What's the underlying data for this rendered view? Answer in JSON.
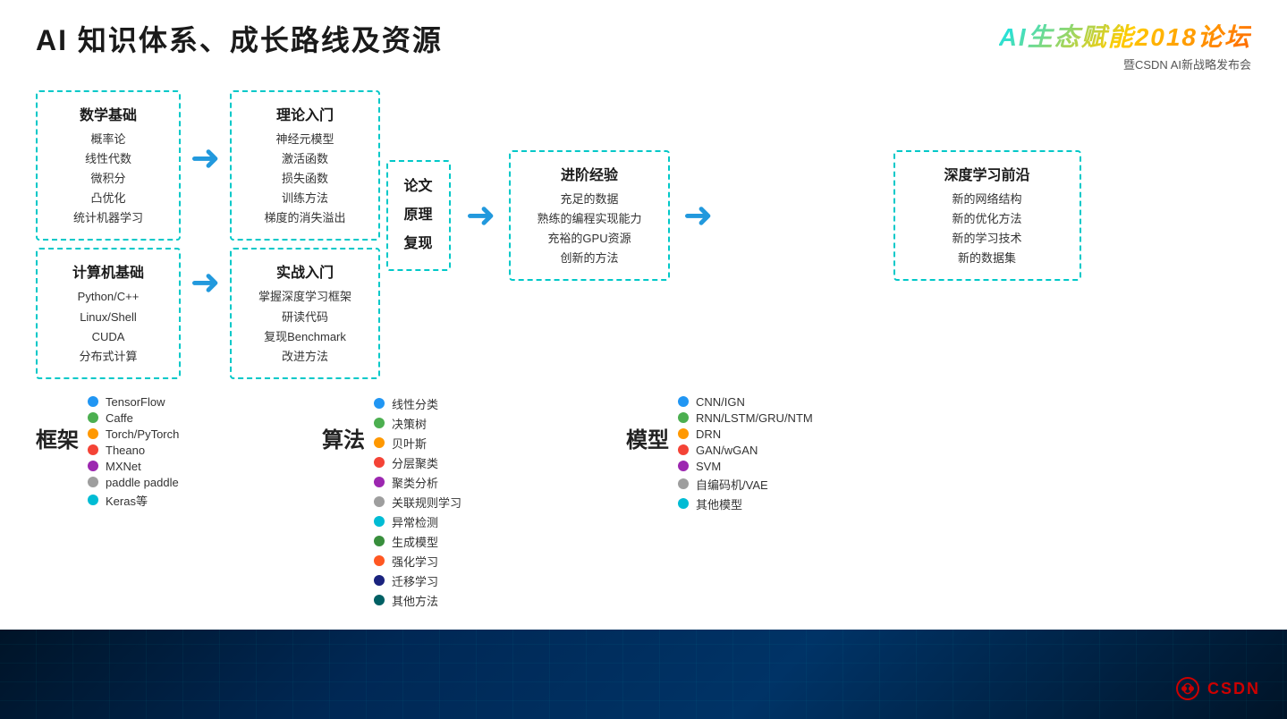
{
  "header": {
    "main_title": "AI 知识体系、成长路线及资源",
    "logo_title": "AI生态赋能2018论坛",
    "logo_subtitle": "暨CSDN AI新战略发布会"
  },
  "boxes": {
    "shuxue": {
      "title": "数学基础",
      "items": [
        "概率论",
        "线性代数",
        "微积分",
        "凸优化",
        "统计机器学习"
      ]
    },
    "jisuanji": {
      "title": "计算机基础",
      "items": [
        "Python/C++",
        "Linux/Shell",
        "CUDA",
        "分布式计算"
      ]
    },
    "lilun": {
      "title": "理论入门",
      "items": [
        "神经元模型",
        "激活函数",
        "损失函数",
        "训练方法",
        "梯度的消失溢出"
      ]
    },
    "shizhan": {
      "title": "实战入门",
      "items": [
        "掌握深度学习框架",
        "研读代码",
        "复现Benchmark",
        "改进方法"
      ]
    },
    "lunwen": {
      "lines": [
        "论文",
        "原理",
        "复现"
      ]
    },
    "jinjie": {
      "title": "进阶经验",
      "items": [
        "充足的数据",
        "熟练的编程实现能力",
        "充裕的GPU资源",
        "创新的方法"
      ]
    },
    "shendu": {
      "title": "深度学习前沿",
      "items": [
        "新的网络结构",
        "新的优化方法",
        "新的学习技术",
        "新的数据集"
      ]
    }
  },
  "categories": {
    "kuangjia": {
      "label": "框架",
      "items": [
        {
          "color": "#2196F3",
          "text": "TensorFlow"
        },
        {
          "color": "#4CAF50",
          "text": "Caffe"
        },
        {
          "color": "#FF9800",
          "text": "Torch/PyTorch"
        },
        {
          "color": "#F44336",
          "text": "Theano"
        },
        {
          "color": "#9C27B0",
          "text": "MXNet"
        },
        {
          "color": "#9E9E9E",
          "text": "paddle paddle"
        },
        {
          "color": "#00BCD4",
          "text": "Keras等"
        }
      ]
    },
    "suanfa": {
      "label": "算法",
      "items": [
        {
          "color": "#2196F3",
          "text": "线性分类"
        },
        {
          "color": "#4CAF50",
          "text": "决策树"
        },
        {
          "color": "#FF9800",
          "text": "贝叶斯"
        },
        {
          "color": "#F44336",
          "text": "分层聚类"
        },
        {
          "color": "#9C27B0",
          "text": "聚类分析"
        },
        {
          "color": "#9E9E9E",
          "text": "关联规则学习"
        },
        {
          "color": "#00BCD4",
          "text": "异常检测"
        },
        {
          "color": "#388E3C",
          "text": "生成模型"
        },
        {
          "color": "#FF5722",
          "text": "强化学习"
        },
        {
          "color": "#1A237E",
          "text": "迁移学习"
        },
        {
          "color": "#006064",
          "text": "其他方法"
        }
      ]
    },
    "moxing": {
      "label": "模型",
      "items": [
        {
          "color": "#2196F3",
          "text": "CNN/IGN"
        },
        {
          "color": "#4CAF50",
          "text": "RNN/LSTM/GRU/NTM"
        },
        {
          "color": "#FF9800",
          "text": "DRN"
        },
        {
          "color": "#F44336",
          "text": "GAN/wGAN"
        },
        {
          "color": "#9C27B0",
          "text": "SVM"
        },
        {
          "color": "#9E9E9E",
          "text": "自编码机/VAE"
        },
        {
          "color": "#00BCD4",
          "text": "其他模型"
        }
      ]
    }
  },
  "csdn": {
    "logo_text": "CSDN"
  }
}
